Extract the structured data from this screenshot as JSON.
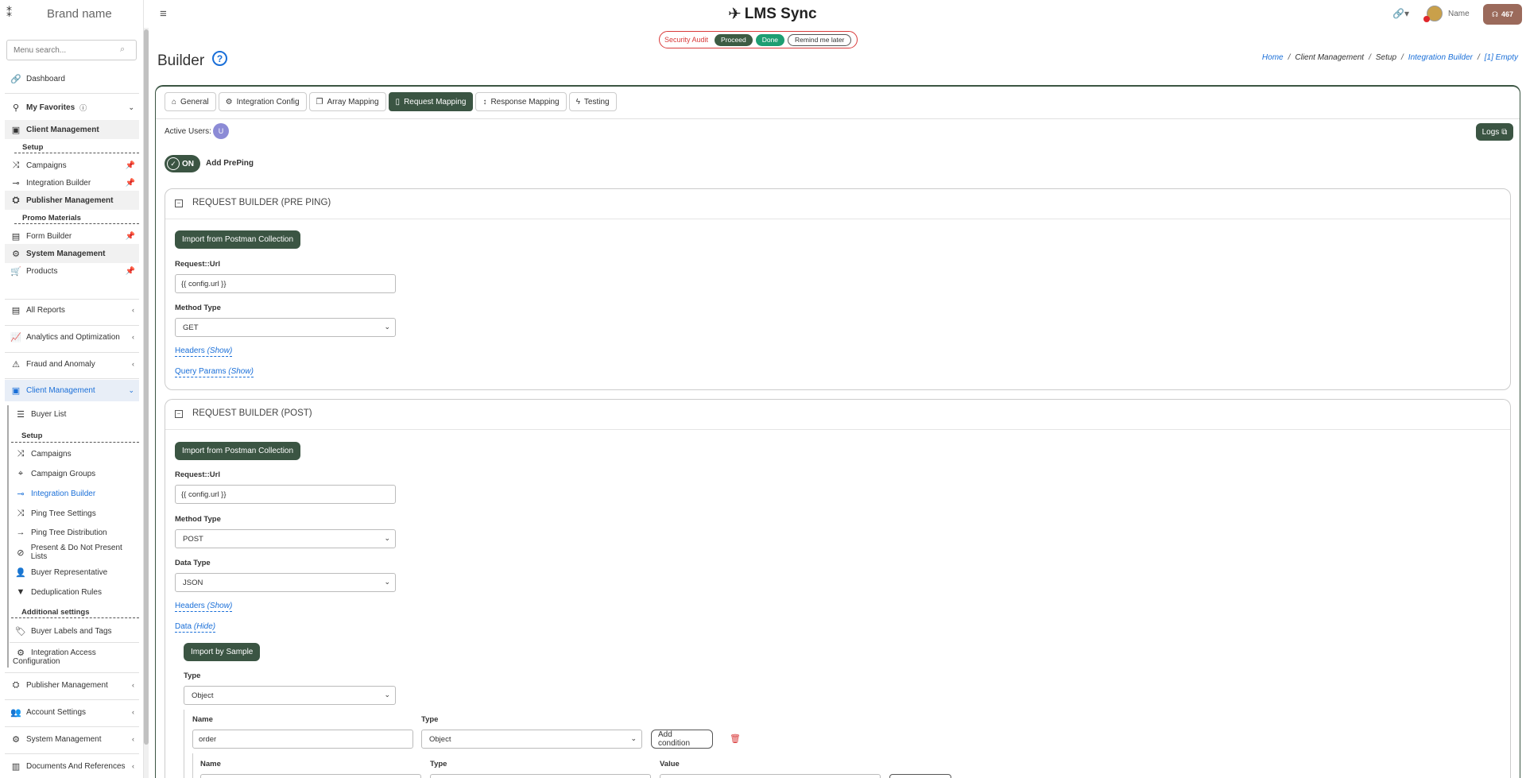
{
  "brand": {
    "name": "Brand name"
  },
  "app": {
    "title": "LMS Sync"
  },
  "sidebar": {
    "search_placeholder": "Menu search...",
    "dashboard": "Dashboard",
    "favorites": "My Favorites",
    "fav_client_mgmt": "Client Management",
    "fav_setup": "Setup",
    "fav_campaigns": "Campaigns",
    "fav_integration_builder": "Integration Builder",
    "fav_publisher_mgmt": "Publisher Management",
    "fav_promo": "Promo Materials",
    "fav_form_builder": "Form Builder",
    "fav_system_mgmt": "System Management",
    "fav_products": "Products",
    "all_reports": "All Reports",
    "analytics": "Analytics and Optimization",
    "fraud": "Fraud and Anomaly",
    "client_mgmt": "Client Management",
    "buyer_list": "Buyer List",
    "setup": "Setup",
    "campaigns": "Campaigns",
    "campaign_groups": "Campaign Groups",
    "integration_builder": "Integration Builder",
    "ping_tree_settings": "Ping Tree Settings",
    "ping_tree_distribution": "Ping Tree Distribution",
    "present_lists": "Present & Do Not Present Lists",
    "buyer_rep": "Buyer Representative",
    "dedup": "Deduplication Rules",
    "additional": "Additional settings",
    "labels_tags": "Buyer Labels and Tags",
    "integration_access_1": "Integration Access",
    "integration_access_2": "Configuration",
    "publisher_mgmt": "Publisher Management",
    "account_settings": "Account Settings",
    "system_mgmt": "System Management",
    "docs": "Documents And References"
  },
  "topbar": {
    "user_name": "Name",
    "badge_count": "467"
  },
  "audit": {
    "label": "Security Audit",
    "proceed": "Proceed",
    "done": "Done",
    "later": "Remind me later"
  },
  "page": {
    "title": "Builder",
    "help": "?"
  },
  "breadcrumb": {
    "home": "Home",
    "client": "Client Management",
    "setup": "Setup",
    "integration": "Integration Builder",
    "current": "[1] Empty"
  },
  "tabs": [
    "General",
    "Integration Config",
    "Array Mapping",
    "Request Mapping",
    "Response Mapping",
    "Testing"
  ],
  "active_users": {
    "label": "Active Users:",
    "initial": "U"
  },
  "logs": "Logs",
  "toggle": {
    "state": "ON",
    "label": "Add PrePing"
  },
  "preping": {
    "title": "REQUEST BUILDER (PRE PING)",
    "import": "Import from Postman Collection",
    "url_label": "Request::Url",
    "url_value": "{{ config.url }}",
    "method_label": "Method Type",
    "method_value": "GET",
    "headers": "Headers",
    "headers_action": "(Show)",
    "query": "Query Params",
    "query_action": "(Show)"
  },
  "post": {
    "title": "REQUEST BUILDER (POST)",
    "import": "Import from Postman Collection",
    "url_label": "Request::Url",
    "url_value": "{{ config.url }}",
    "method_label": "Method Type",
    "method_value": "POST",
    "datatype_label": "Data Type",
    "datatype_value": "JSON",
    "headers": "Headers",
    "headers_action": "(Show)",
    "data": "Data",
    "data_action": "(Hide)",
    "import_sample": "Import by Sample",
    "type_label": "Type",
    "type_value": "Object",
    "name_label": "Name",
    "type2_label": "Type",
    "field_name": "order",
    "field_type": "Object",
    "add_condition": "Add condition",
    "name3_label": "Name",
    "type3_label": "Type",
    "value3_label": "Value"
  }
}
